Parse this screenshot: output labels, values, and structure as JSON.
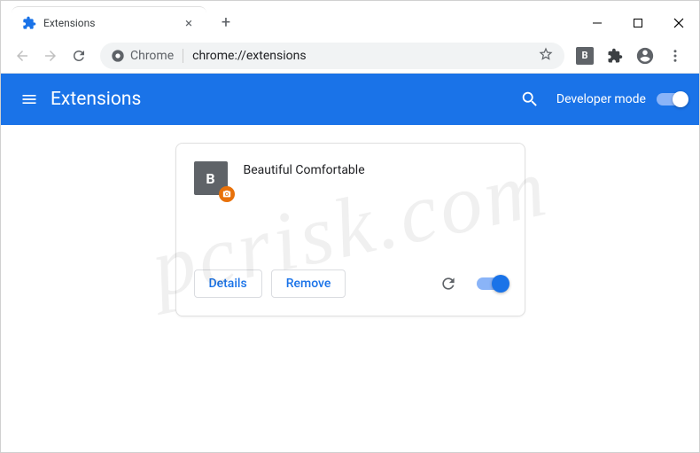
{
  "tab": {
    "title": "Extensions"
  },
  "omnibox": {
    "chip": "Chrome",
    "url": "chrome://extensions"
  },
  "header": {
    "title": "Extensions",
    "devmode_label": "Developer mode"
  },
  "extension": {
    "name": "Beautiful Comfortable",
    "icon_letter": "B",
    "details_label": "Details",
    "remove_label": "Remove"
  },
  "toolbar_ext_badge": "B",
  "watermark": "pcrisk.com"
}
